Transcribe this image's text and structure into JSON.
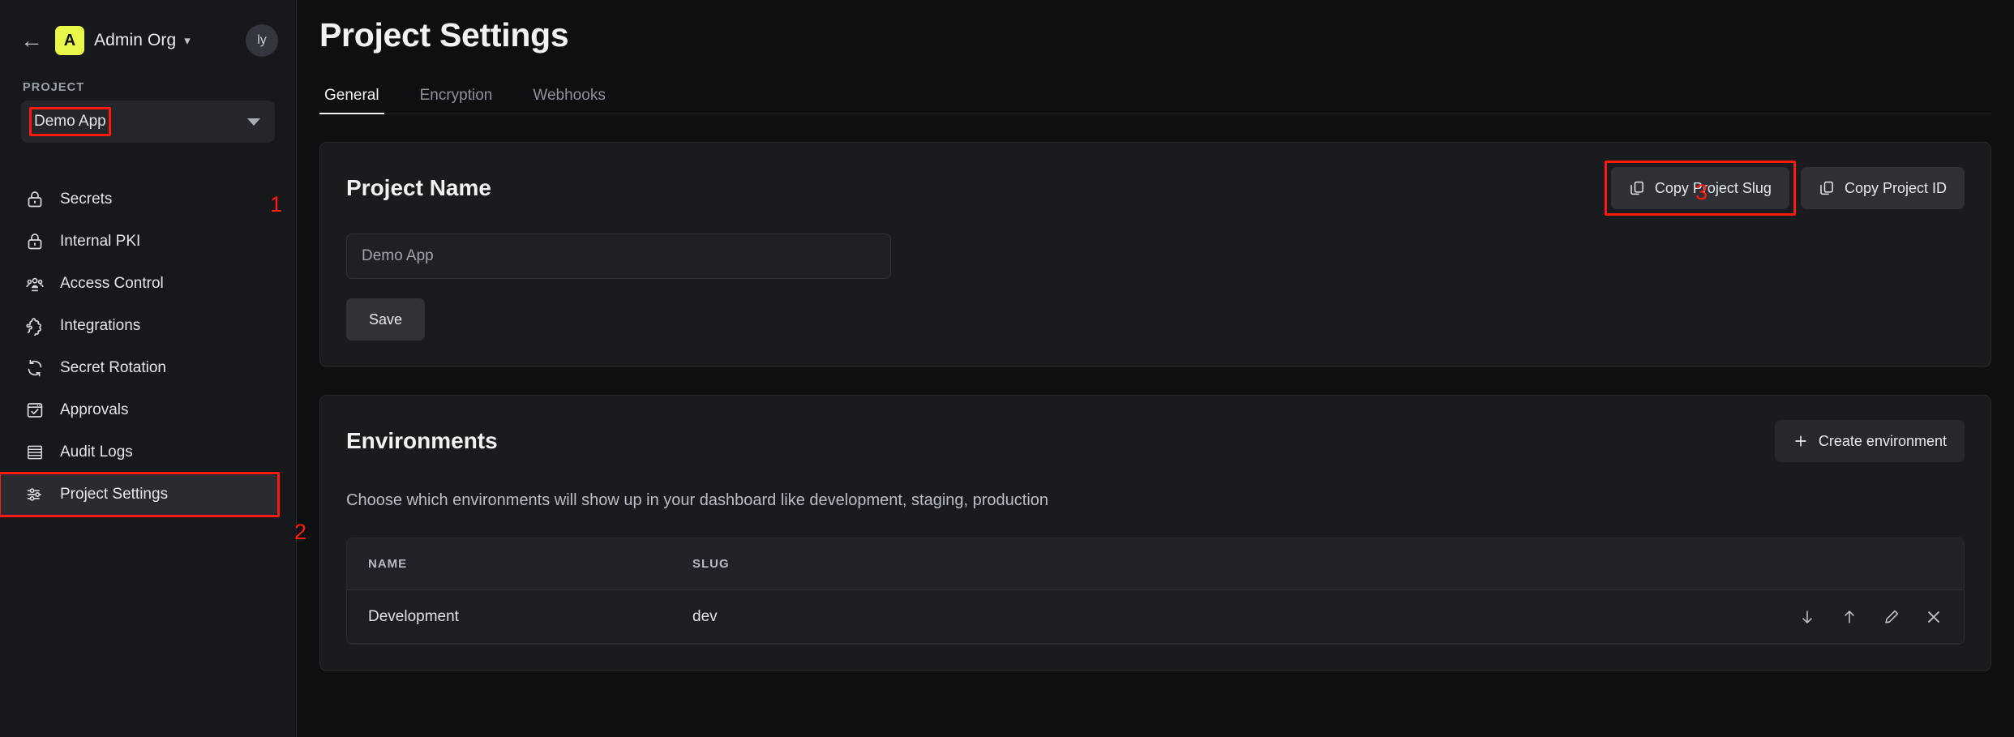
{
  "sidebar": {
    "back_icon": "arrow-left-icon",
    "org_initial": "A",
    "org_name": "Admin Org",
    "org_caret": "chevron-down-icon",
    "avatar_initials": "ly",
    "project_label": "PROJECT",
    "project_selected": "Demo App",
    "nav_items": [
      {
        "label": "Secrets",
        "icon": "lock-icon",
        "active": false
      },
      {
        "label": "Internal PKI",
        "icon": "lock-icon",
        "active": false
      },
      {
        "label": "Access Control",
        "icon": "users-icon",
        "active": false
      },
      {
        "label": "Integrations",
        "icon": "puzzle-icon",
        "active": false
      },
      {
        "label": "Secret Rotation",
        "icon": "refresh-icon",
        "active": false
      },
      {
        "label": "Approvals",
        "icon": "approval-check-icon",
        "active": false
      },
      {
        "label": "Audit Logs",
        "icon": "list-rows-icon",
        "active": false
      },
      {
        "label": "Project Settings",
        "icon": "sliders-icon",
        "active": true
      }
    ]
  },
  "main": {
    "page_title": "Project Settings",
    "tabs": [
      {
        "label": "General",
        "active": true
      },
      {
        "label": "Encryption",
        "active": false
      },
      {
        "label": "Webhooks",
        "active": false
      }
    ],
    "project_name_card": {
      "title": "Project Name",
      "copy_slug_label": "Copy Project Slug",
      "copy_id_label": "Copy Project ID",
      "input_value": "Demo App",
      "input_placeholder": "Demo App",
      "save_label": "Save"
    },
    "environments_card": {
      "title": "Environments",
      "create_label": "Create environment",
      "create_icon": "plus-icon",
      "description": "Choose which environments will show up in your dashboard like development, staging, production",
      "columns": [
        "NAME",
        "SLUG"
      ],
      "rows": [
        {
          "name": "Development",
          "slug": "dev",
          "actions": [
            "move-down-icon",
            "move-up-icon",
            "edit-pencil-icon",
            "delete-close-icon"
          ]
        }
      ]
    }
  },
  "annotations": {
    "accent_color": "#ff1a10",
    "markers": [
      {
        "number": "1"
      },
      {
        "number": "2"
      },
      {
        "number": "3"
      }
    ]
  }
}
